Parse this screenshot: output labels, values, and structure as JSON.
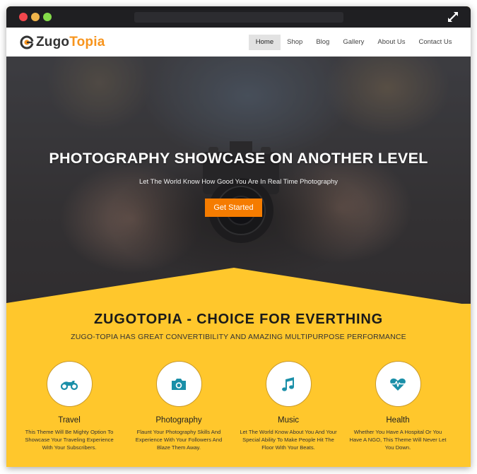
{
  "window": {
    "controls": [
      "close",
      "minimize",
      "maximize"
    ],
    "expand_icon": "expand-arrows-icon"
  },
  "header": {
    "logo_icon": "logo-c-icon",
    "logo_part1": "Zugo",
    "logo_part2": "Topia",
    "nav": [
      {
        "label": "Home",
        "active": true
      },
      {
        "label": "Shop",
        "active": false
      },
      {
        "label": "Blog",
        "active": false
      },
      {
        "label": "Gallery",
        "active": false
      },
      {
        "label": "About Us",
        "active": false
      },
      {
        "label": "Contact Us",
        "active": false
      }
    ]
  },
  "hero": {
    "title": "PHOTOGRAPHY SHOWCASE ON ANOTHER LEVEL",
    "subtitle": "Let The World Know How Good You Are In Real Time Photography",
    "cta_label": "Get Started"
  },
  "section": {
    "title": "ZUGOTOPIA - CHOICE FOR EVERTHING",
    "subtitle": "ZUGO-TOPIA HAS GREAT CONVERTIBILITY AND AMAZING MULTIPURPOSE PERFORMANCE",
    "features": [
      {
        "icon": "motorcycle-icon",
        "title": "Travel",
        "description": "This Theme Will Be Mighty Option To Showcase Your Traveling Experience With Your Subscribers."
      },
      {
        "icon": "camera-icon",
        "title": "Photography",
        "description": "Flaunt Your Photography Skills And Experience With Your Followers And Blaze Them Away."
      },
      {
        "icon": "music-note-icon",
        "title": "Music",
        "description": "Let The World Know About You And Your Special Ability To Make People Hit The Floor With Your Beats."
      },
      {
        "icon": "heartbeat-icon",
        "title": "Health",
        "description": "Whether You Have A Hospital Or You Have A NGO, This Theme Will Never Let You Down."
      }
    ]
  },
  "colors": {
    "accent_orange": "#f57c00",
    "logo_orange": "#f7941d",
    "section_yellow": "#ffc72c",
    "icon_teal": "#1a8fa8",
    "titlebar": "#1f1f22"
  }
}
